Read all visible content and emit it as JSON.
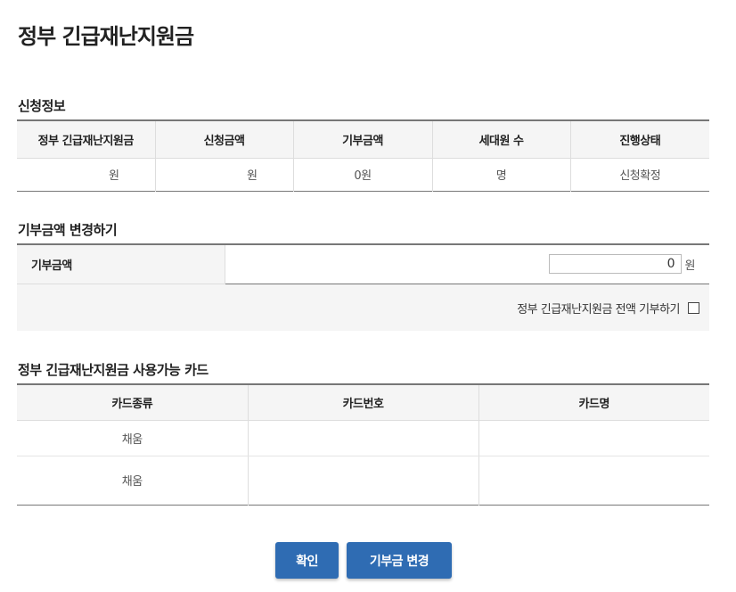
{
  "page_title": "정부 긴급재난지원금",
  "info_section": {
    "title": "신청정보",
    "headers": [
      "정부 긴급재난지원금",
      "신청금액",
      "기부금액",
      "세대원 수",
      "진행상태"
    ],
    "row": [
      "원",
      "원",
      "0원",
      "명",
      "신청확정"
    ]
  },
  "donate_section": {
    "title": "기부금액 변경하기",
    "label": "기부금액",
    "amount_value": "0",
    "unit": "원",
    "full_donate_label": "정부 긴급재난지원금 전액 기부하기"
  },
  "card_section": {
    "title": "정부 긴급재난지원금 사용가능 카드",
    "headers": [
      "카드종류",
      "카드번호",
      "카드명"
    ],
    "rows": [
      [
        "채움",
        "",
        ""
      ],
      [
        "채움",
        "",
        ""
      ]
    ]
  },
  "buttons": {
    "confirm": "확인",
    "change": "기부금 변경"
  },
  "colors": {
    "button_bg": "#2f6cb3",
    "header_bg": "#f5f5f5"
  }
}
